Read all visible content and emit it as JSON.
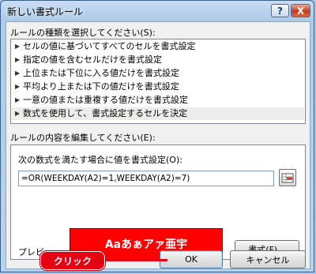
{
  "window": {
    "title": "新しい書式ルール",
    "help_label": "?",
    "close_label": "X"
  },
  "rule_type": {
    "label": "ルールの種類を選択してください(S):",
    "items": [
      {
        "label": "セルの値に基づいてすべてのセルを書式設定"
      },
      {
        "label": "指定の値を含むセルだけを書式設定"
      },
      {
        "label": "上位または下位に入る値だけを書式設定"
      },
      {
        "label": "平均より上または下の値だけを書式設定"
      },
      {
        "label": "一意の値または重複する値だけを書式設定"
      },
      {
        "label": "数式を使用して、書式設定するセルを決定"
      }
    ],
    "selected_index": 5
  },
  "rule_description": {
    "label": "ルールの内容を編集してください(E):",
    "formula_label": "次の数式を満たす場合に値を書式設定(O):",
    "formula_value": "=OR(WEEKDAY(A2)=1,WEEKDAY(A2)=7)",
    "preview_label": "プレビュー:",
    "preview_sample": "Aaあぁアァ亜宇",
    "preview_fill": "#ff0000",
    "format_button": "書式(F)..."
  },
  "buttons": {
    "ok": "OK",
    "cancel": "キャンセル"
  },
  "annotation": {
    "label": "クリック",
    "color": "#e60012"
  }
}
